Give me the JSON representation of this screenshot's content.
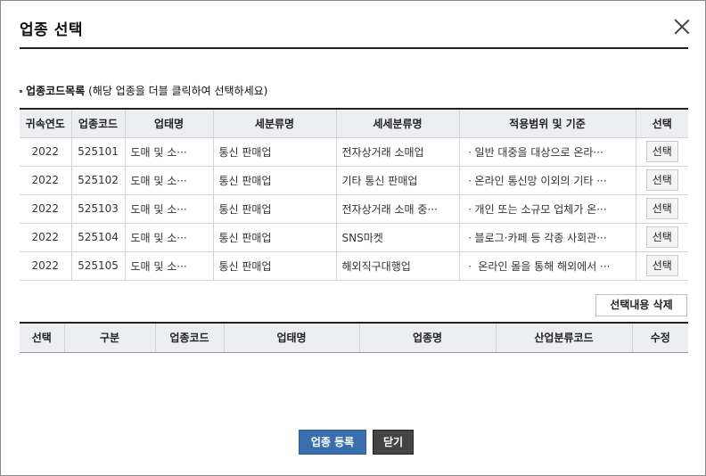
{
  "dialog": {
    "title": "업종 선택",
    "close_icon": "close-icon"
  },
  "section": {
    "heading": "업종코드목록",
    "hint": "(해당 업종을 더블 클릭하여 선택하세요)"
  },
  "code_table": {
    "columns": [
      "귀속연도",
      "업종코드",
      "업태명",
      "세분류명",
      "세세분류명",
      "적용범위 및 기준",
      "선택"
    ],
    "rows": [
      {
        "year": "2022",
        "code": "525101",
        "business": "도매 및 소···",
        "sub": "통신 판매업",
        "subsub": "전자상거래 소매업",
        "scope": "ㆍ일반 대중을 대상으로 온라···",
        "select": "선택"
      },
      {
        "year": "2022",
        "code": "525102",
        "business": "도매 및 소···",
        "sub": "통신 판매업",
        "subsub": "기타 통신 판매업",
        "scope": "ㆍ온라인 통신망 이외의 기타 ···",
        "select": "선택"
      },
      {
        "year": "2022",
        "code": "525103",
        "business": "도매 및 소···",
        "sub": "통신 판매업",
        "subsub": "전자상거래 소매 중···",
        "scope": "ㆍ개인 또는 소규모 업체가 온···",
        "select": "선택"
      },
      {
        "year": "2022",
        "code": "525104",
        "business": "도매 및 소···",
        "sub": "통신 판매업",
        "subsub": "SNS마켓",
        "scope": "ㆍ블로그·카페 등 각종 사회관···",
        "select": "선택"
      },
      {
        "year": "2022",
        "code": "525105",
        "business": "도매 및 소···",
        "sub": "통신 판매업",
        "subsub": "해외직구대행업",
        "scope": "ㆍ 온라인 몰을 통해 해외에서 ···",
        "select": "선택"
      }
    ]
  },
  "delete_button": "선택내용 삭제",
  "selected_table": {
    "columns": [
      "선택",
      "구분",
      "업종코드",
      "업태명",
      "업종명",
      "산업분류코드",
      "수정"
    ]
  },
  "footer": {
    "register_label": "업종 등록",
    "close_label": "닫기"
  }
}
